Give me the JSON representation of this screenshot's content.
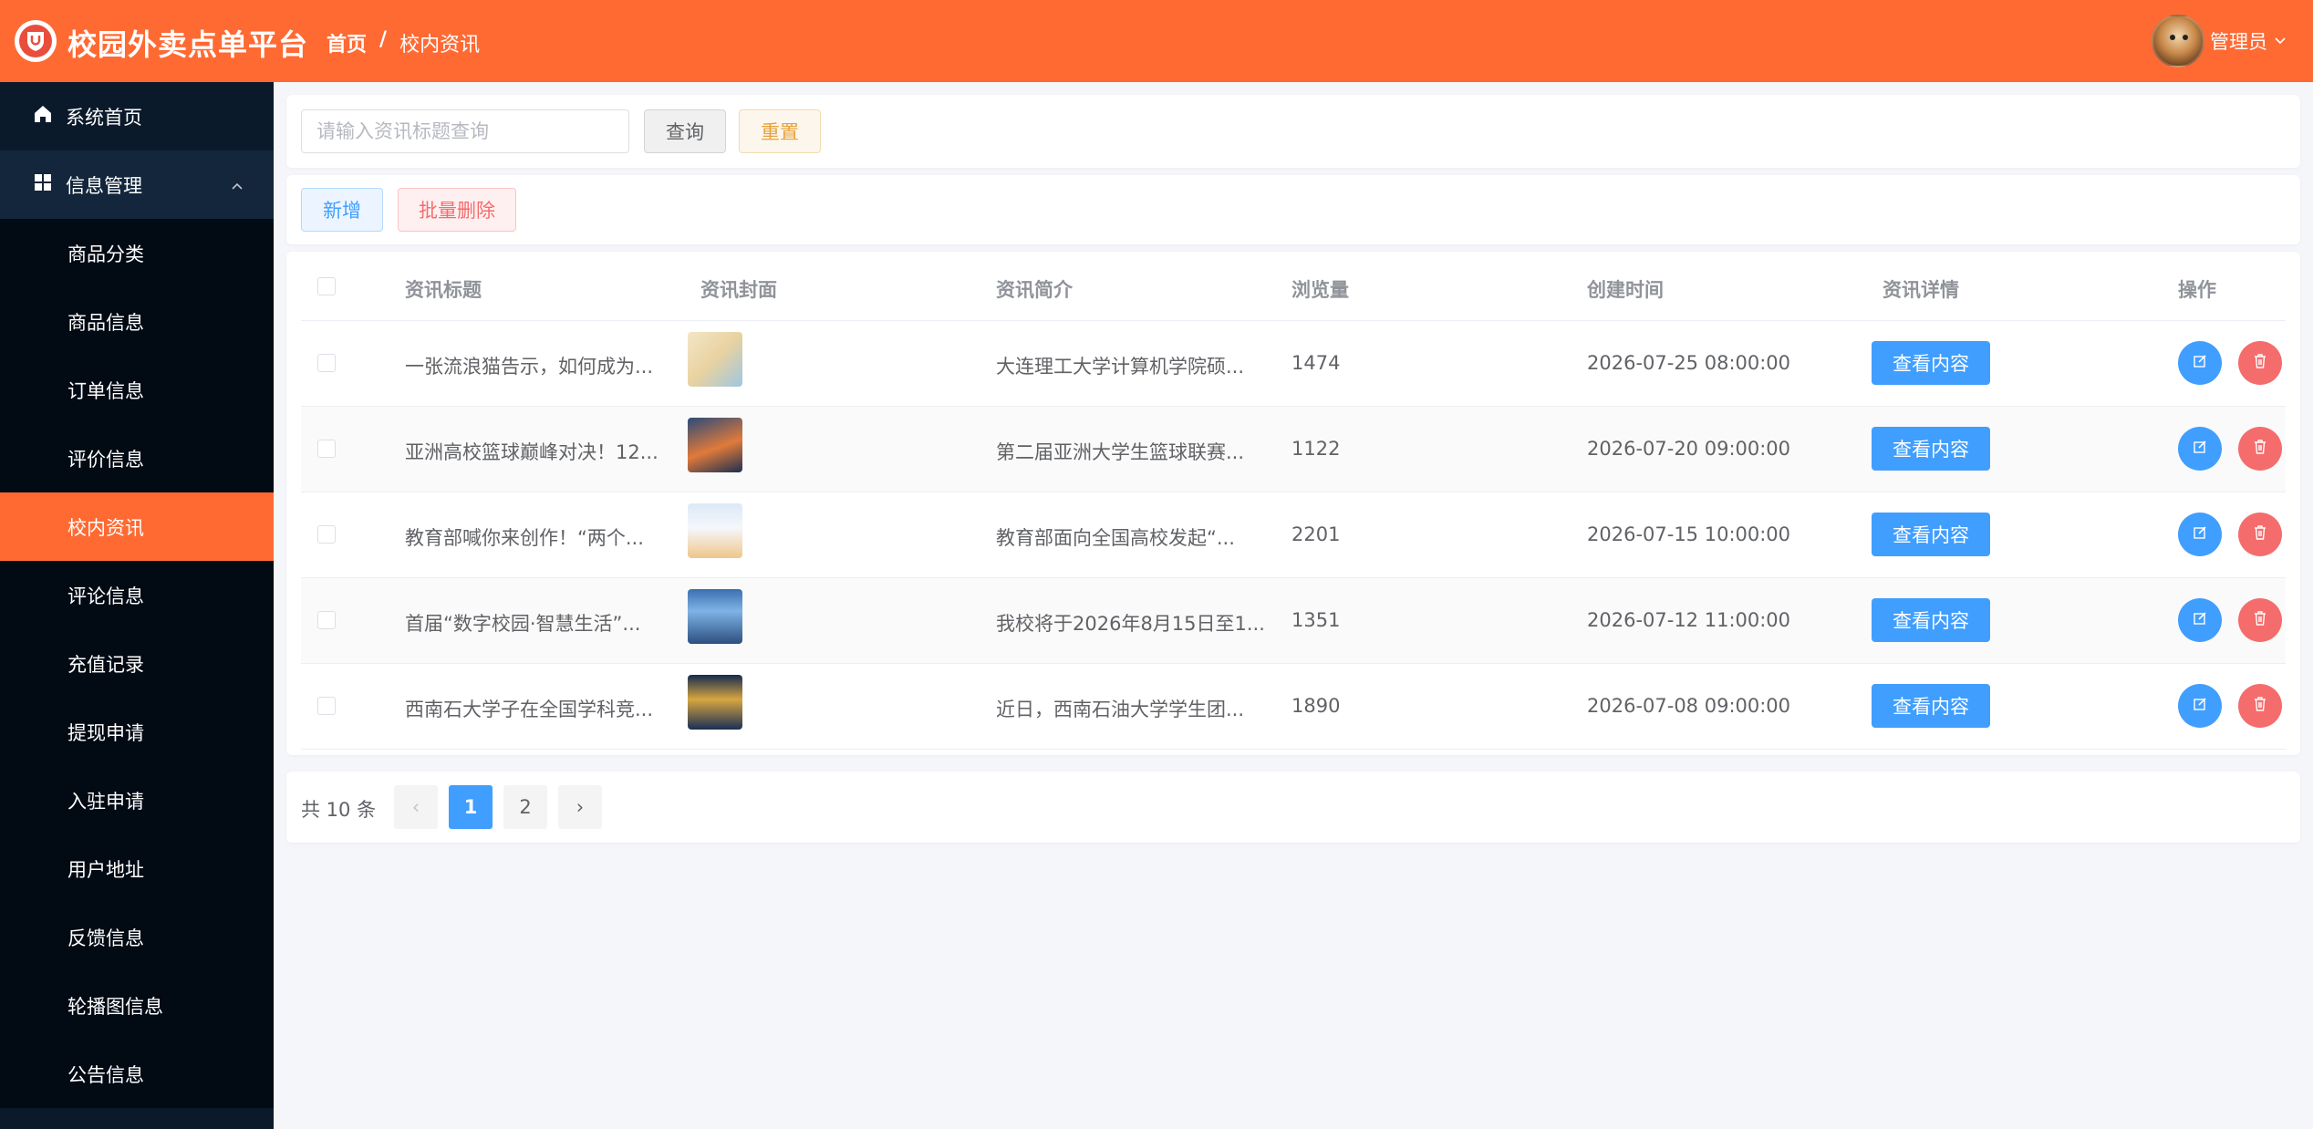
{
  "header": {
    "title": "校园外卖点单平台",
    "breadcrumb": {
      "home": "首页",
      "separator": "/",
      "current": "校内资讯"
    },
    "user": {
      "name": "管理员"
    },
    "bg_color": "#ff6a33"
  },
  "sidebar": {
    "items": [
      {
        "label": "系统首页",
        "icon": "home-icon"
      },
      {
        "label": "信息管理",
        "icon": "grid-icon",
        "expanded": true
      },
      {
        "label": "商品分类"
      },
      {
        "label": "商品信息"
      },
      {
        "label": "订单信息"
      },
      {
        "label": "评价信息"
      },
      {
        "label": "校内资讯",
        "active": true
      },
      {
        "label": "评论信息"
      },
      {
        "label": "充值记录"
      },
      {
        "label": "提现申请"
      },
      {
        "label": "入驻申请"
      },
      {
        "label": "用户地址"
      },
      {
        "label": "反馈信息"
      },
      {
        "label": "轮播图信息"
      },
      {
        "label": "公告信息"
      }
    ]
  },
  "search": {
    "placeholder": "请输入资讯标题查询",
    "query_label": "查询",
    "reset_label": "重置"
  },
  "actions": {
    "add_label": "新增",
    "batch_delete_label": "批量删除"
  },
  "table": {
    "columns": [
      "资讯标题",
      "资讯封面",
      "资讯简介",
      "浏览量",
      "创建时间",
      "资讯详情",
      "操作"
    ],
    "view_label": "查看内容",
    "rows": [
      {
        "title": "一张流浪猫告示，如何成为...",
        "summary": "大连理工大学计算机学院硕...",
        "views": "1474",
        "created": "2026-07-25 08:00:00"
      },
      {
        "title": "亚洲高校篮球巅峰对决！12...",
        "summary": "第二届亚洲大学生篮球联赛...",
        "views": "1122",
        "created": "2026-07-20 09:00:00"
      },
      {
        "title": "教育部喊你来创作！“两个...",
        "summary": "教育部面向全国高校发起“...",
        "views": "2201",
        "created": "2026-07-15 10:00:00"
      },
      {
        "title": "首届“数字校园·智慧生活”...",
        "summary": "我校将于2026年8月15日至1...",
        "views": "1351",
        "created": "2026-07-12 11:00:00"
      },
      {
        "title": "西南石大学子在全国学科竞...",
        "summary": "近日，西南石油大学学生团...",
        "views": "1890",
        "created": "2026-07-08 09:00:00"
      }
    ]
  },
  "pagination": {
    "total_text": "共 10 条",
    "pages": [
      "1",
      "2"
    ],
    "current": "1",
    "prev_icon": "‹",
    "next_icon": "›"
  }
}
